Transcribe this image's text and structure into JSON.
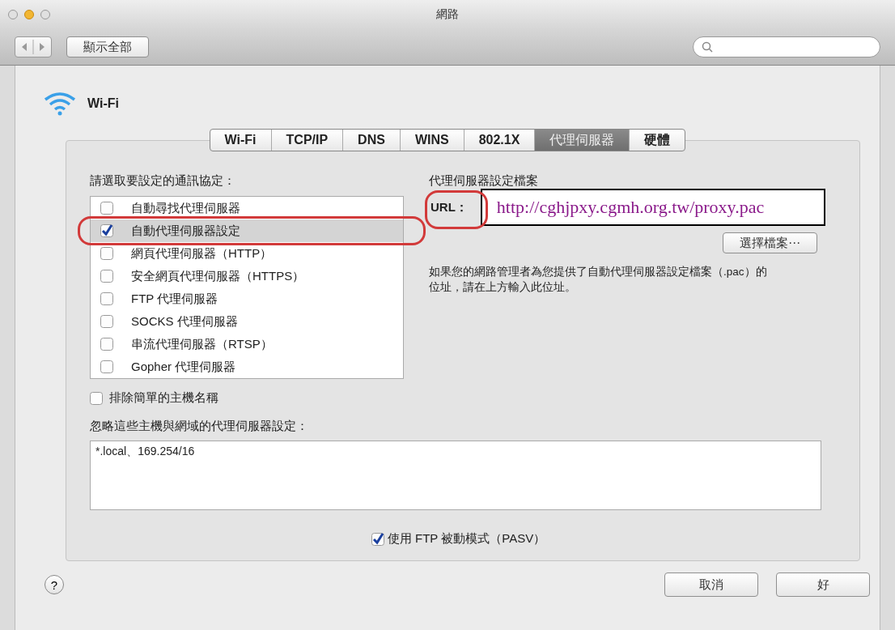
{
  "window": {
    "title": "網路"
  },
  "toolbar": {
    "show_all": "顯示全部"
  },
  "service": {
    "name": "Wi-Fi"
  },
  "tabs": [
    {
      "label": "Wi-Fi",
      "selected": false
    },
    {
      "label": "TCP/IP",
      "selected": false
    },
    {
      "label": "DNS",
      "selected": false
    },
    {
      "label": "WINS",
      "selected": false
    },
    {
      "label": "802.1X",
      "selected": false
    },
    {
      "label": "代理伺服器",
      "selected": true
    },
    {
      "label": "硬體",
      "selected": false
    }
  ],
  "protocols": {
    "label": "請選取要設定的通訊協定：",
    "items": [
      {
        "label": "自動尋找代理伺服器",
        "checked": false,
        "selected": false
      },
      {
        "label": "自動代理伺服器設定",
        "checked": true,
        "selected": true
      },
      {
        "label": "網頁代理伺服器（HTTP）",
        "checked": false,
        "selected": false
      },
      {
        "label": "安全網頁代理伺服器（HTTPS）",
        "checked": false,
        "selected": false
      },
      {
        "label": "FTP 代理伺服器",
        "checked": false,
        "selected": false
      },
      {
        "label": "SOCKS 代理伺服器",
        "checked": false,
        "selected": false
      },
      {
        "label": "串流代理伺服器（RTSP）",
        "checked": false,
        "selected": false
      },
      {
        "label": "Gopher 代理伺服器",
        "checked": false,
        "selected": false
      }
    ]
  },
  "config_file": {
    "label": "代理伺服器設定檔案",
    "url_label": "URL：",
    "url": "http://cghjpxy.cgmh.org.tw/proxy.pac",
    "choose_button": "選擇檔案⋯",
    "help": "如果您的網路管理者為您提供了自動代理伺服器設定檔案（.pac）的位址，請在上方輸入此位址。"
  },
  "exclude_simple": {
    "label": "排除簡單的主機名稱",
    "checked": false
  },
  "bypass": {
    "label": "忽略這些主機與網域的代理伺服器設定：",
    "value": "*.local、169.254/16"
  },
  "passive_ftp": {
    "label": "使用 FTP 被動模式（PASV）",
    "checked": true
  },
  "help_button": "?",
  "buttons": [
    {
      "label": "取消"
    },
    {
      "label": "好"
    }
  ]
}
